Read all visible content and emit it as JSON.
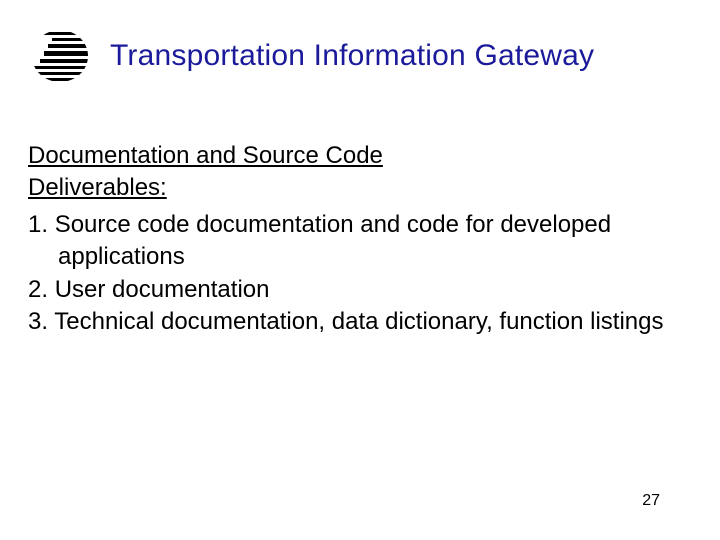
{
  "header": {
    "title": "Transportation Information Gateway"
  },
  "section": {
    "heading_line1": "Documentation and Source Code",
    "heading_line2": "Deliverables:"
  },
  "items": [
    {
      "num": "1.",
      "text": "Source code documentation and code for developed applications"
    },
    {
      "num": "2.",
      "text": "User documentation"
    },
    {
      "num": "3.",
      "text": "Technical documentation, data dictionary, function listings"
    }
  ],
  "page_number": "27"
}
